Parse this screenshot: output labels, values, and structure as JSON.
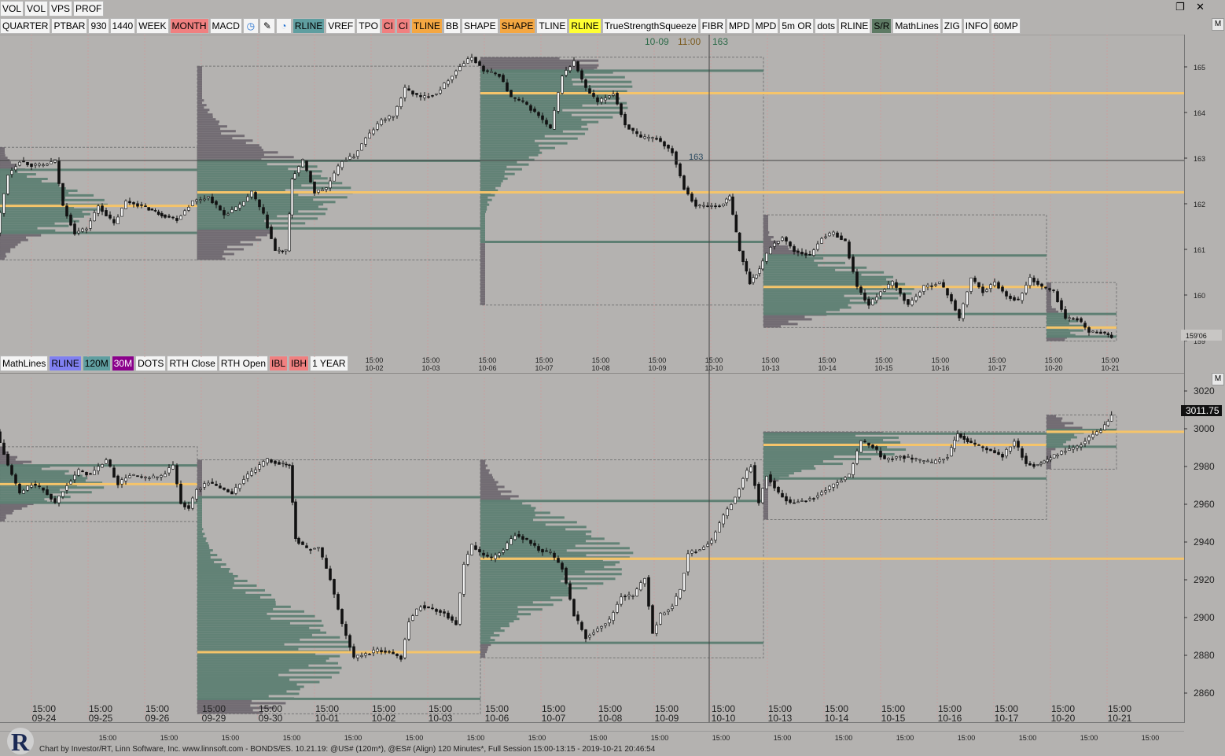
{
  "topbar": [
    "VOL",
    "VOL",
    "VPS",
    "PROF"
  ],
  "toolbar1": [
    {
      "label": "QUARTER"
    },
    {
      "label": "PTBAR"
    },
    {
      "label": "930"
    },
    {
      "label": "1440"
    },
    {
      "label": "WEEK"
    },
    {
      "label": "MONTH",
      "bg": "#f08080"
    },
    {
      "label": "MACD"
    },
    {
      "icon": "clock-icon",
      "glyph": "◷",
      "color": "#1f6fd0"
    },
    {
      "icon": "pencil-icon",
      "glyph": "✎",
      "color": "#000"
    },
    {
      "icon": "stopwatch-icon",
      "glyph": "◔",
      "color": "#1f6fd0"
    },
    {
      "label": "RLINE",
      "bg": "#5f9ea0"
    },
    {
      "label": "VREF"
    },
    {
      "label": "TPO"
    },
    {
      "label": "CI",
      "bg": "#f08080"
    },
    {
      "label": "CI",
      "bg": "#f08080"
    },
    {
      "label": "TLINE",
      "bg": "#f4a742"
    },
    {
      "label": "BB"
    },
    {
      "label": "SHAPE"
    },
    {
      "label": "SHAPE",
      "bg": "#f4a742"
    },
    {
      "label": "TLINE"
    },
    {
      "label": "RLINE",
      "bg": "#ffff33"
    },
    {
      "label": "TrueStrengthSqueeze"
    },
    {
      "label": "FIBR"
    },
    {
      "label": "MPD"
    },
    {
      "label": "MPD"
    },
    {
      "label": "5m OR"
    },
    {
      "label": "dots"
    },
    {
      "label": "RLINE"
    },
    {
      "label": "S/R",
      "bg": "#5e7a64"
    },
    {
      "label": "MathLines"
    },
    {
      "label": "ZIG"
    },
    {
      "label": "INFO"
    },
    {
      "label": "60MP"
    }
  ],
  "toolbar2": [
    {
      "label": "MathLines"
    },
    {
      "label": "RLINE",
      "bg": "#8080f0"
    },
    {
      "label": "120M",
      "bg": "#5f9ea0"
    },
    {
      "label": "30M",
      "bg": "#8b008b",
      "color": "#ffffff"
    },
    {
      "label": "DOTS"
    },
    {
      "label": "RTH Close"
    },
    {
      "label": "RTH Open"
    },
    {
      "label": "IBL",
      "bg": "#f08080"
    },
    {
      "label": "IBH",
      "bg": "#f08080"
    },
    {
      "label": "1 YEAR"
    }
  ],
  "crosshair_label": {
    "date": "10-09",
    "time": "11:00",
    "value": "163"
  },
  "crosshair_tag": "163",
  "window_controls": {
    "restore": "❐",
    "close": "✕"
  },
  "pane_buttons": [
    "M",
    "M"
  ],
  "chart_data": [
    {
      "type": "candlestick",
      "name": "@US# (120m*)",
      "ylim": [
        158.8,
        165.8
      ],
      "yticks": [
        "165",
        "164",
        "163",
        "162",
        "161",
        "160",
        "159"
      ],
      "current_price": "159'06",
      "x_labels": [
        {
          "t": "15:00",
          "d": "10-02"
        },
        {
          "t": "15:00",
          "d": "10-03"
        },
        {
          "t": "15:00",
          "d": "10-06"
        },
        {
          "t": "15:00",
          "d": "10-07"
        },
        {
          "t": "15:00",
          "d": "10-08"
        },
        {
          "t": "15:00",
          "d": "10-09"
        },
        {
          "t": "15:00",
          "d": "10-10"
        },
        {
          "t": "15:00",
          "d": "10-13"
        },
        {
          "t": "15:00",
          "d": "10-14"
        },
        {
          "t": "15:00",
          "d": "10-15"
        },
        {
          "t": "15:00",
          "d": "10-16"
        },
        {
          "t": "15:00",
          "d": "10-17"
        },
        {
          "t": "15:00",
          "d": "10-20"
        },
        {
          "t": "15:00",
          "d": "10-21"
        }
      ],
      "path": [
        [
          0,
          161.4
        ],
        [
          15,
          162.7
        ],
        [
          30,
          163.0
        ],
        [
          45,
          162.9
        ],
        [
          60,
          162.9
        ],
        [
          75,
          163.0
        ],
        [
          85,
          162.0
        ],
        [
          100,
          161.4
        ],
        [
          115,
          161.5
        ],
        [
          130,
          162.0
        ],
        [
          150,
          161.6
        ],
        [
          165,
          162.1
        ],
        [
          185,
          162.0
        ],
        [
          210,
          161.8
        ],
        [
          230,
          161.7
        ],
        [
          250,
          162.1
        ],
        [
          270,
          162.2
        ],
        [
          290,
          161.8
        ],
        [
          310,
          162.0
        ],
        [
          325,
          162.3
        ],
        [
          340,
          161.8
        ],
        [
          355,
          161.0
        ],
        [
          368,
          161.0
        ],
        [
          375,
          162.6
        ],
        [
          390,
          163.0
        ],
        [
          405,
          162.3
        ],
        [
          420,
          162.4
        ],
        [
          440,
          163.0
        ],
        [
          455,
          163.1
        ],
        [
          470,
          163.5
        ],
        [
          490,
          163.9
        ],
        [
          505,
          164.0
        ],
        [
          520,
          164.6
        ],
        [
          540,
          164.4
        ],
        [
          560,
          164.5
        ],
        [
          575,
          164.8
        ],
        [
          590,
          165.1
        ],
        [
          605,
          165.3
        ],
        [
          620,
          165.0
        ],
        [
          640,
          164.9
        ],
        [
          655,
          164.4
        ],
        [
          670,
          164.3
        ],
        [
          690,
          164.0
        ],
        [
          705,
          163.7
        ],
        [
          720,
          164.9
        ],
        [
          735,
          165.2
        ],
        [
          750,
          164.6
        ],
        [
          765,
          164.3
        ],
        [
          785,
          164.5
        ],
        [
          800,
          163.8
        ],
        [
          820,
          163.5
        ],
        [
          840,
          163.5
        ],
        [
          860,
          163.2
        ],
        [
          875,
          162.4
        ],
        [
          890,
          162.0
        ],
        [
          905,
          162.0
        ],
        [
          920,
          162.0
        ],
        [
          932,
          162.2
        ],
        [
          945,
          161.0
        ],
        [
          958,
          160.3
        ],
        [
          970,
          160.6
        ],
        [
          985,
          161.1
        ],
        [
          1000,
          161.3
        ],
        [
          1015,
          161.0
        ],
        [
          1035,
          160.9
        ],
        [
          1050,
          161.3
        ],
        [
          1065,
          161.4
        ],
        [
          1080,
          161.2
        ],
        [
          1095,
          160.2
        ],
        [
          1110,
          159.8
        ],
        [
          1125,
          160.1
        ],
        [
          1140,
          160.3
        ],
        [
          1160,
          159.8
        ],
        [
          1180,
          160.2
        ],
        [
          1200,
          160.3
        ],
        [
          1215,
          159.9
        ],
        [
          1225,
          159.5
        ],
        [
          1240,
          160.4
        ],
        [
          1255,
          160.1
        ],
        [
          1270,
          160.3
        ],
        [
          1285,
          160.0
        ],
        [
          1300,
          159.9
        ],
        [
          1315,
          160.4
        ],
        [
          1330,
          160.2
        ],
        [
          1345,
          160.1
        ],
        [
          1360,
          159.5
        ],
        [
          1375,
          159.5
        ],
        [
          1390,
          159.2
        ],
        [
          1405,
          159.2
        ],
        [
          1418,
          159.1
        ]
      ],
      "sessions": [
        {
          "x0": 0,
          "x1": 251,
          "hi": 163.3,
          "lo": 160.8,
          "vpoc": 162.0,
          "vah": 162.8,
          "val": 161.4
        },
        {
          "x0": 251,
          "x1": 611,
          "hi": 165.1,
          "lo": 160.8,
          "vpoc": 162.3,
          "vah": 163.0,
          "val": 161.5
        },
        {
          "x0": 611,
          "x1": 971,
          "hi": 165.3,
          "lo": 159.8,
          "vpoc": 164.5,
          "vah": 165.0,
          "val": 161.2
        },
        {
          "x0": 971,
          "x1": 1331,
          "hi": 161.8,
          "lo": 159.3,
          "vpoc": 160.2,
          "vah": 160.9,
          "val": 159.6
        },
        {
          "x0": 1331,
          "x1": 1420,
          "hi": 160.3,
          "lo": 159.0,
          "vpoc": 159.3,
          "vah": 159.6,
          "val": 159.1
        }
      ],
      "extended_levels": [
        {
          "y": 164.5,
          "x0": 611
        },
        {
          "y": 162.3,
          "x0": 251
        }
      ]
    },
    {
      "type": "candlestick",
      "name": "@ES# (Align) 120 Minutes*",
      "ylim": [
        2853,
        3032
      ],
      "yticks": [
        "3020",
        "3000",
        "2980",
        "2960",
        "2940",
        "2920",
        "2900",
        "2880",
        "2860"
      ],
      "current_price": "3011.75",
      "x_labels": [
        {
          "t": "15:00",
          "d": "09-24"
        },
        {
          "t": "15:00",
          "d": "09-25"
        },
        {
          "t": "15:00",
          "d": "09-26"
        },
        {
          "t": "15:00",
          "d": "09-29"
        },
        {
          "t": "15:00",
          "d": "09-30"
        },
        {
          "t": "15:00",
          "d": "10-01"
        },
        {
          "t": "15:00",
          "d": "10-02"
        },
        {
          "t": "15:00",
          "d": "10-03"
        },
        {
          "t": "15:00",
          "d": "10-06"
        },
        {
          "t": "15:00",
          "d": "10-07"
        },
        {
          "t": "15:00",
          "d": "10-08"
        },
        {
          "t": "15:00",
          "d": "10-09"
        },
        {
          "t": "15:00",
          "d": "10-10"
        },
        {
          "t": "15:00",
          "d": "10-13"
        },
        {
          "t": "15:00",
          "d": "10-14"
        },
        {
          "t": "15:00",
          "d": "10-15"
        },
        {
          "t": "15:00",
          "d": "10-16"
        },
        {
          "t": "15:00",
          "d": "10-17"
        },
        {
          "t": "15:00",
          "d": "10-20"
        },
        {
          "t": "15:00",
          "d": "10-21"
        }
      ],
      "path": [
        [
          0,
          3003
        ],
        [
          15,
          2985
        ],
        [
          30,
          2970
        ],
        [
          45,
          2975
        ],
        [
          60,
          2972
        ],
        [
          75,
          2965
        ],
        [
          90,
          2975
        ],
        [
          105,
          2982
        ],
        [
          120,
          2980
        ],
        [
          140,
          2988
        ],
        [
          155,
          2975
        ],
        [
          170,
          2980
        ],
        [
          190,
          2978
        ],
        [
          210,
          2979
        ],
        [
          225,
          2985
        ],
        [
          235,
          2965
        ],
        [
          245,
          2962
        ],
        [
          255,
          2972
        ],
        [
          270,
          2976
        ],
        [
          285,
          2973
        ],
        [
          300,
          2970
        ],
        [
          315,
          2978
        ],
        [
          330,
          2983
        ],
        [
          345,
          2988
        ],
        [
          360,
          2986
        ],
        [
          372,
          2985
        ],
        [
          380,
          2946
        ],
        [
          395,
          2940
        ],
        [
          410,
          2941
        ],
        [
          425,
          2924
        ],
        [
          440,
          2900
        ],
        [
          455,
          2882
        ],
        [
          470,
          2884
        ],
        [
          485,
          2886
        ],
        [
          500,
          2885
        ],
        [
          515,
          2882
        ],
        [
          525,
          2902
        ],
        [
          540,
          2910
        ],
        [
          555,
          2908
        ],
        [
          570,
          2906
        ],
        [
          585,
          2900
        ],
        [
          595,
          2932
        ],
        [
          605,
          2942
        ],
        [
          615,
          2938
        ],
        [
          630,
          2935
        ],
        [
          645,
          2940
        ],
        [
          660,
          2948
        ],
        [
          675,
          2945
        ],
        [
          690,
          2940
        ],
        [
          705,
          2938
        ],
        [
          720,
          2930
        ],
        [
          735,
          2905
        ],
        [
          750,
          2893
        ],
        [
          765,
          2898
        ],
        [
          780,
          2902
        ],
        [
          795,
          2915
        ],
        [
          810,
          2915
        ],
        [
          825,
          2925
        ],
        [
          835,
          2895
        ],
        [
          845,
          2905
        ],
        [
          860,
          2910
        ],
        [
          870,
          2918
        ],
        [
          880,
          2938
        ],
        [
          895,
          2940
        ],
        [
          910,
          2945
        ],
        [
          925,
          2958
        ],
        [
          940,
          2968
        ],
        [
          950,
          2978
        ],
        [
          960,
          2985
        ],
        [
          970,
          2965
        ],
        [
          980,
          2980
        ],
        [
          995,
          2970
        ],
        [
          1010,
          2965
        ],
        [
          1025,
          2966
        ],
        [
          1040,
          2968
        ],
        [
          1055,
          2972
        ],
        [
          1070,
          2976
        ],
        [
          1085,
          2980
        ],
        [
          1100,
          2998
        ],
        [
          1115,
          2995
        ],
        [
          1130,
          2988
        ],
        [
          1150,
          2990
        ],
        [
          1170,
          2988
        ],
        [
          1190,
          2986
        ],
        [
          1210,
          2990
        ],
        [
          1222,
          3002
        ],
        [
          1235,
          2998
        ],
        [
          1250,
          2995
        ],
        [
          1265,
          2993
        ],
        [
          1280,
          2990
        ],
        [
          1295,
          2998
        ],
        [
          1310,
          2986
        ],
        [
          1320,
          2985
        ],
        [
          1332,
          2987
        ],
        [
          1345,
          2990
        ],
        [
          1360,
          2993
        ],
        [
          1375,
          2995
        ],
        [
          1390,
          3000
        ],
        [
          1405,
          3004
        ],
        [
          1418,
          3011
        ]
      ],
      "sessions": [
        {
          "x0": 0,
          "x1": 251,
          "hi": 2995,
          "lo": 2955,
          "vpoc": 2975,
          "vah": 2985,
          "val": 2965
        },
        {
          "x0": 251,
          "x1": 611,
          "hi": 2988,
          "lo": 2852,
          "vpoc": 2885,
          "vah": 2968,
          "val": 2860
        },
        {
          "x0": 611,
          "x1": 971,
          "hi": 2988,
          "lo": 2882,
          "vpoc": 2935,
          "vah": 2966,
          "val": 2890
        },
        {
          "x0": 971,
          "x1": 1331,
          "hi": 3003,
          "lo": 2956,
          "vpoc": 2996,
          "vah": 3002,
          "val": 2978
        },
        {
          "x0": 1331,
          "x1": 1420,
          "hi": 3012,
          "lo": 2983,
          "vpoc": 3003,
          "vah": 3004,
          "val": 2995
        }
      ],
      "extended_levels": [
        {
          "y": 2935,
          "x0": 611
        },
        {
          "y": 3003,
          "x0": 1331
        }
      ]
    }
  ],
  "bottom_axis": [
    "15:00",
    "15:00",
    "15:00",
    "15:00",
    "15:00",
    "15:00",
    "15:00",
    "15:00",
    "15:00",
    "15:00",
    "15:00",
    "15:00",
    "15:00",
    "15:00",
    "15:00",
    "15:00",
    "15:00",
    "15:00"
  ],
  "footer": "Chart by Investor/RT, Linn Software, Inc. www.linnsoft.com - BONDS/ES.   10.21.19: @US# (120m*), @ES# (Align) 120 Minutes*, Full Session 15:00-13:15 - 2019-10-21 20:46:54",
  "colors": {
    "bg": "#b4b2b0",
    "profile": "#5e7f73",
    "profile_upper": "#6f6870",
    "vpoc": "#f5c46a",
    "level": "#5e7f73",
    "grid": "#c9a0a0"
  }
}
